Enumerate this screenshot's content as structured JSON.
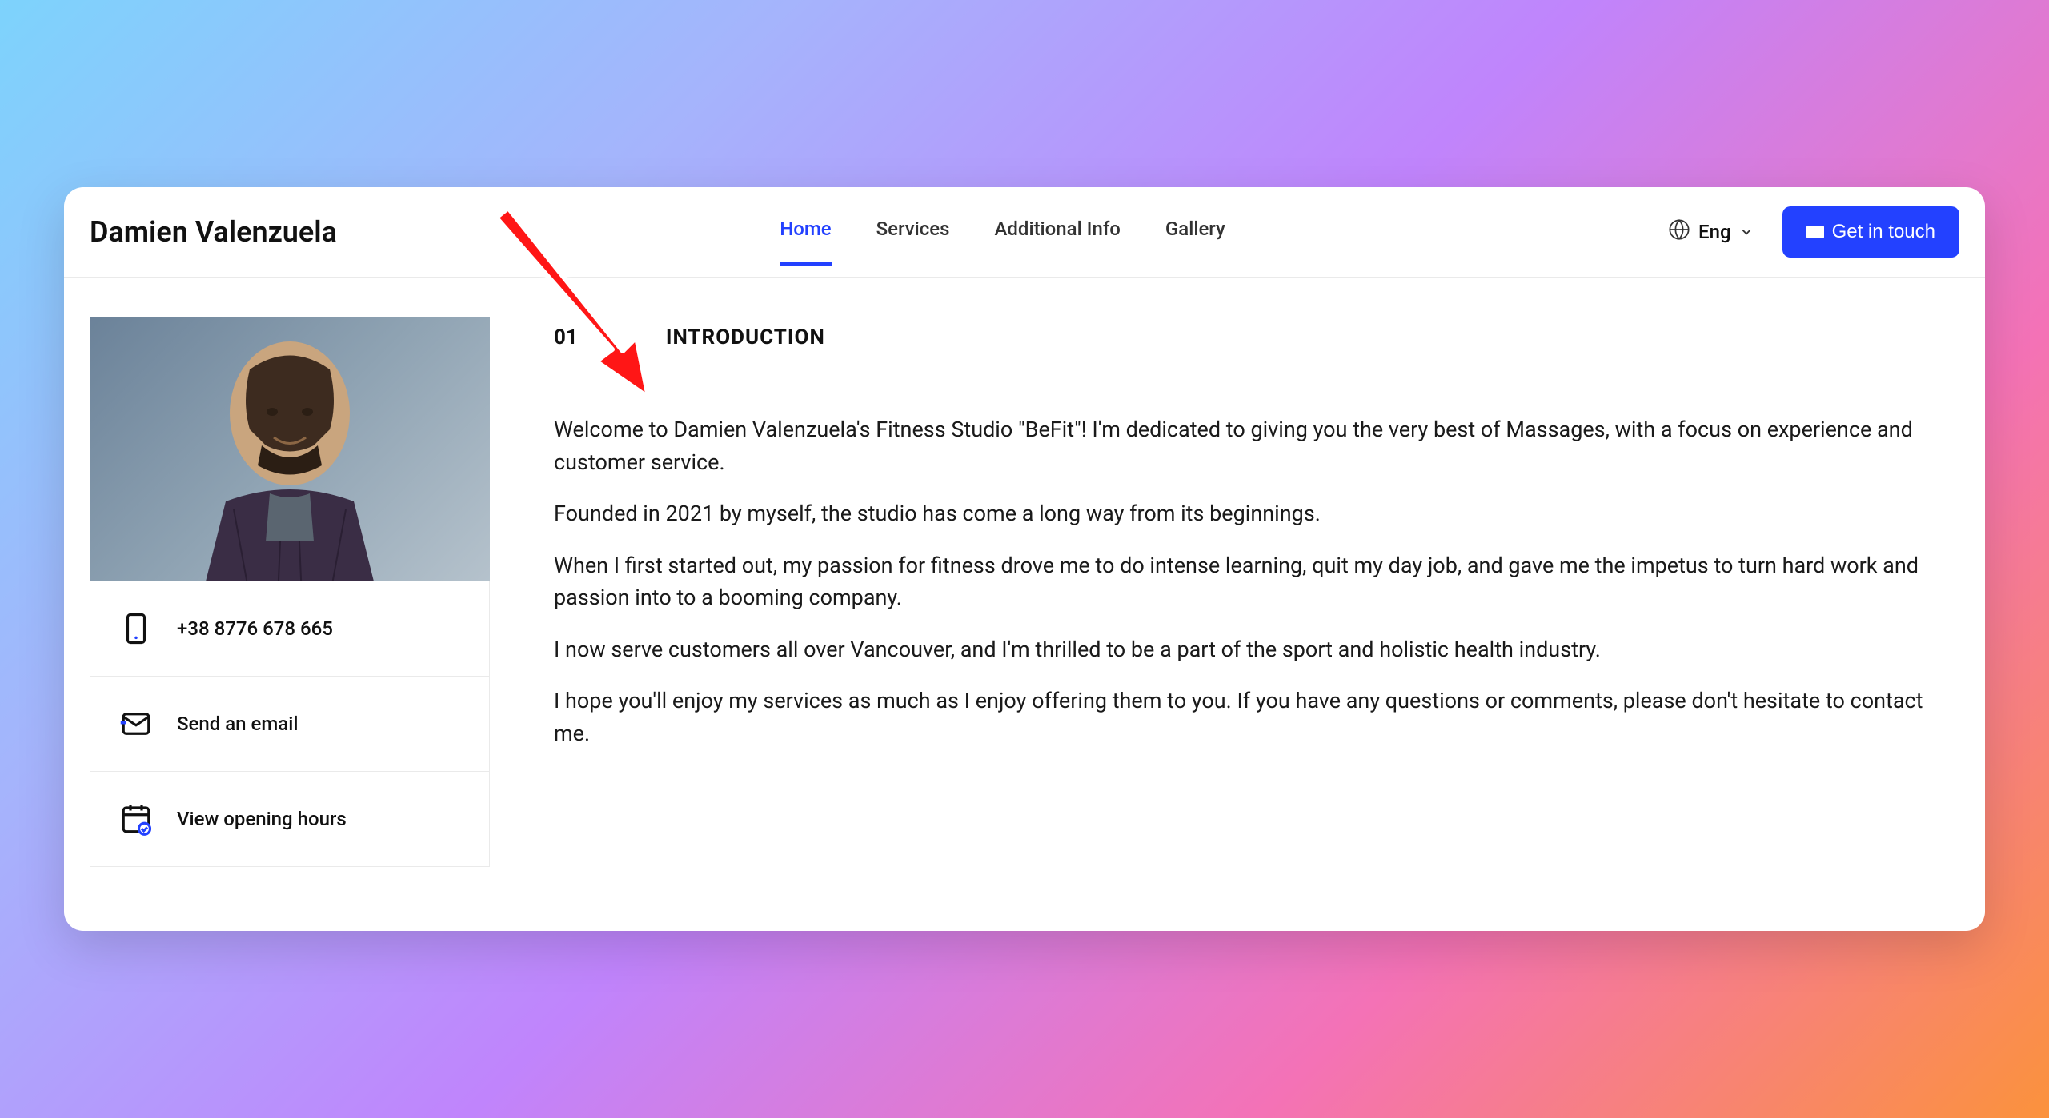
{
  "header": {
    "site_title": "Damien Valenzuela",
    "nav": {
      "home": "Home",
      "services": "Services",
      "additional_info": "Additional Info",
      "gallery": "Gallery"
    },
    "language": "Eng",
    "cta_label": "Get in touch"
  },
  "sidebar": {
    "phone": "+38 8776 678 665",
    "email_label": "Send an email",
    "hours_label": "View opening hours"
  },
  "main": {
    "section_number": "01",
    "section_title": "INTRODUCTION",
    "paragraphs": {
      "p1": "Welcome to Damien Valenzuela's Fitness Studio \"BeFit\"! I'm dedicated to giving you the very best of Massages, with a focus on experience and customer service.",
      "p2": "Founded in 2021 by myself, the studio has come a long way from its beginnings.",
      "p3": "When I first started out, my passion for fitness drove me to do intense learning, quit my day job, and gave me the impetus to turn hard work and passion into to a booming company.",
      "p4": "I now serve customers all over Vancouver, and I'm thrilled to be a part of the sport and holistic health industry.",
      "p5": "I hope you'll enjoy my services as much as I enjoy offering them to you. If you have any questions or comments, please don't hesitate to contact me."
    }
  }
}
